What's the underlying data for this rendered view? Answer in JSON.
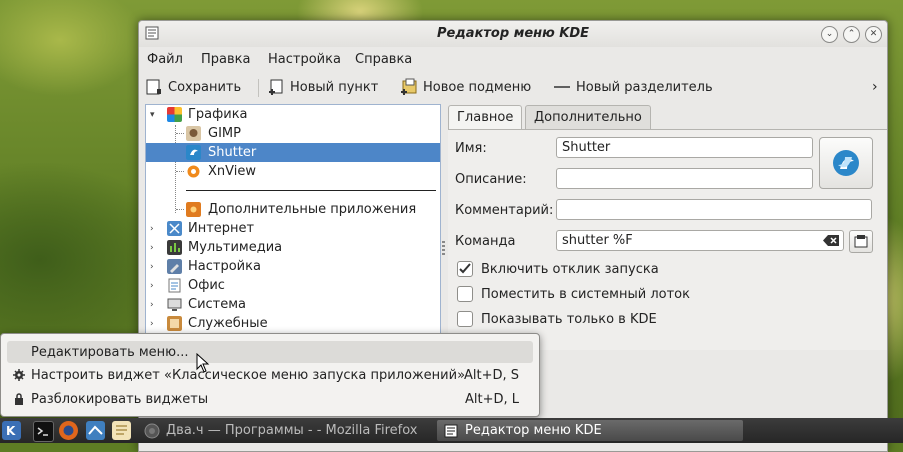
{
  "window": {
    "title": "Редактор меню KDE"
  },
  "menubar": [
    "Файл",
    "Правка",
    "Настройка",
    "Справка"
  ],
  "toolbar": {
    "save": "Сохранить",
    "new_item": "Новый пункт",
    "new_submenu": "Новое подменю",
    "new_separator": "Новый разделитель",
    "overflow": "›"
  },
  "tree": {
    "graphics": "Графика",
    "gimp": "GIMP",
    "shutter": "Shutter",
    "xnview": "XnView",
    "extra_apps": "Дополнительные приложения",
    "internet": "Интернет",
    "multimedia": "Мультимедиа",
    "settings": "Настройка",
    "office": "Офис",
    "system": "Система",
    "utilities": "Служебные"
  },
  "tabs": {
    "general": "Главное",
    "advanced": "Дополнительно"
  },
  "form": {
    "name_label": "Имя:",
    "name_value": "Shutter",
    "description_label": "Описание:",
    "comment_label": "Комментарий:",
    "command_label": "Команда",
    "command_value": "shutter %F",
    "launch_feedback": "Включить отклик запуска",
    "system_tray": "Поместить в системный лоток",
    "only_kde": "Показывать только в KDE"
  },
  "popup": {
    "edit_menu": "Редактировать меню...",
    "configure_widget": "Настроить виджет «Классическое меню запуска приложений»",
    "configure_shortcut": "Alt+D, S",
    "unlock_widgets": "Разблокировать виджеты",
    "unlock_shortcut": "Alt+D, L"
  },
  "taskbar": {
    "firefox_task": "Два.ч — Программы - - Mozilla Firefox",
    "kmenuedit_task": "Редактор меню KDE"
  }
}
